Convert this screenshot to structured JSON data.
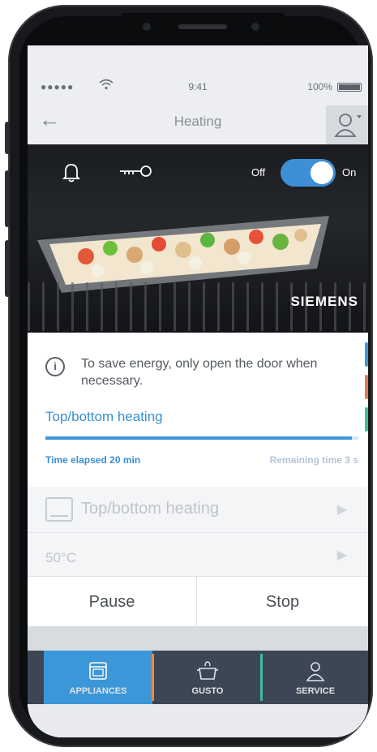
{
  "status": {
    "signal_dots": "●●●●●",
    "time": "9:41",
    "battery_pct": "100%"
  },
  "nav": {
    "title": "Heating"
  },
  "oven": {
    "toggle_off_label": "Off",
    "toggle_on_label": "On",
    "toggle_state": "on",
    "brand": "SIEMENS"
  },
  "info": {
    "text": "To save energy, only open the door when necessary."
  },
  "program": {
    "name": "Top/bottom heating",
    "progress": 0.98,
    "elapsed": "Time elapsed 20 min",
    "remaining": "Remaining time 3 s"
  },
  "list": {
    "items": [
      {
        "label": "Top/bottom heating"
      },
      {
        "label": "50°C"
      }
    ]
  },
  "actions": {
    "pause": "Pause",
    "stop": "Stop"
  },
  "tabs": [
    {
      "label": "APPLIANCES",
      "icon": "appliance-icon",
      "active": true,
      "accent": "#f08a3a"
    },
    {
      "label": "GUSTO",
      "icon": "cooking-pot-icon",
      "active": false,
      "accent": "#3fbf9a"
    },
    {
      "label": "SERVICE",
      "icon": "service-person-icon",
      "active": false,
      "accent": ""
    }
  ],
  "colors": {
    "accent": "#3d97d9",
    "tabbar": "#3d4654",
    "brand_text": "#ffffff"
  }
}
